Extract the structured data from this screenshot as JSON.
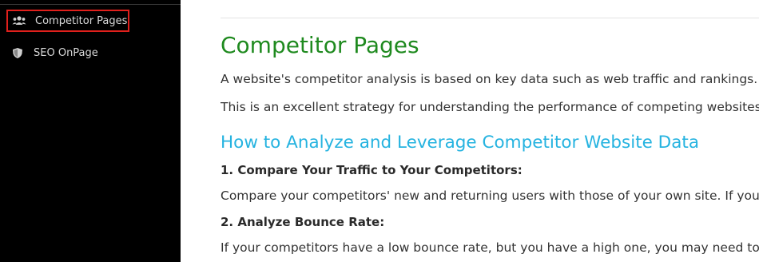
{
  "sidebar": {
    "items": [
      {
        "label": "Competitor Pages",
        "icon": "users-icon",
        "active": true
      },
      {
        "label": "SEO OnPage",
        "icon": "shield-icon",
        "active": false
      }
    ]
  },
  "content": {
    "title": "Competitor Pages",
    "intro1": "A website's competitor analysis is based on key data such as web traffic and rankings.",
    "intro2": "This is an excellent strategy for understanding the performance of competing websites.",
    "subheading": "How to Analyze and Leverage Competitor Website Data",
    "step1_title": "1. Compare Your Traffic to Your Competitors:",
    "step1_text": "Compare your competitors' new and returning users with those of your own site. If you h",
    "step2_title": "2. Analyze Bounce Rate:",
    "step2_text": "If your competitors have a low bounce rate, but you have a high one, you may need to im"
  },
  "colors": {
    "sidebar_bg": "#000000",
    "active_border": "#e0201c",
    "title": "#1f8a1f",
    "subheading": "#25b3e0"
  }
}
